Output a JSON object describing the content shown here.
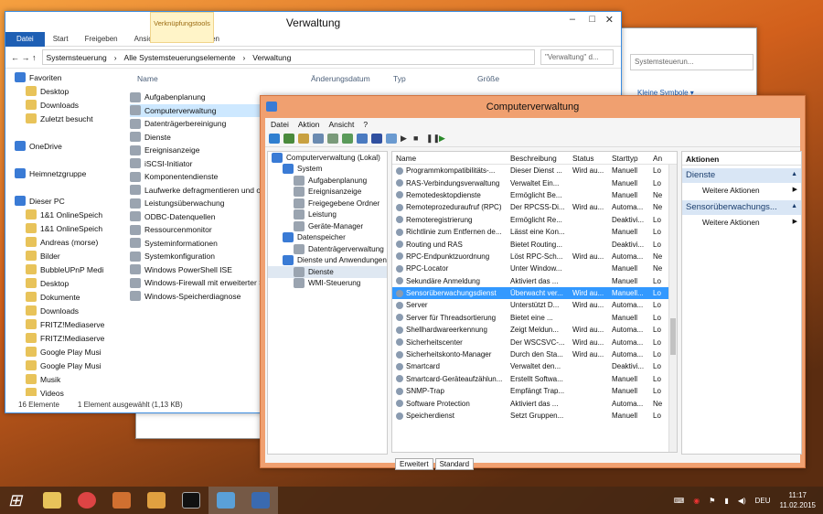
{
  "explorer": {
    "title": "Verwaltung",
    "ctx_tool": "Verknüpfungstools",
    "tabs": [
      "Datei",
      "Start",
      "Freigeben",
      "Ansicht",
      "Verwalten"
    ],
    "path": [
      "Systemsteuerung",
      "Alle Systemsteuerungselemente",
      "Verwaltung"
    ],
    "search_placeholder": "\"Verwaltung\" d...",
    "nav": [
      {
        "label": "Favoriten",
        "hd": true
      },
      {
        "label": "Desktop"
      },
      {
        "label": "Downloads"
      },
      {
        "label": "Zuletzt besucht"
      },
      {
        "label": ""
      },
      {
        "label": "OneDrive",
        "hd": true
      },
      {
        "label": ""
      },
      {
        "label": "Heimnetzgruppe",
        "hd": true
      },
      {
        "label": ""
      },
      {
        "label": "Dieser PC",
        "hd": true
      },
      {
        "label": "1&1 OnlineSpeich"
      },
      {
        "label": "1&1 OnlineSpeich"
      },
      {
        "label": "Andreas (morse)"
      },
      {
        "label": "Bilder"
      },
      {
        "label": "BubbleUPnP Medi"
      },
      {
        "label": "Desktop"
      },
      {
        "label": "Dokumente"
      },
      {
        "label": "Downloads"
      },
      {
        "label": "FRITZ!Mediaserve"
      },
      {
        "label": "FRITZ!Mediaserve"
      },
      {
        "label": "Google Play Musi"
      },
      {
        "label": "Google Play Musi"
      },
      {
        "label": "Musik"
      },
      {
        "label": "Videos"
      }
    ],
    "columns": [
      "Name",
      "Änderungsdatum",
      "Typ",
      "Größe"
    ],
    "files": [
      "Aufgabenplanung",
      "Computerverwaltung",
      "Datenträgerbereinigung",
      "Dienste",
      "Ereignisanzeige",
      "iSCSI-Initiator",
      "Komponentendienste",
      "Laufwerke defragmentieren und o",
      "Leistungsüberwachung",
      "ODBC-Datenquellen",
      "Ressourcenmonitor",
      "Systeminformationen",
      "Systemkonfiguration",
      "Windows PowerShell ISE",
      "Windows-Firewall mit erweiterter S",
      "Windows-Speicherdiagnose"
    ],
    "status_count": "16 Elemente",
    "status_sel": "1 Element ausgewählt (1,13 KB)"
  },
  "back": {
    "search": "Systemsteuerun...",
    "view": "Kleine Symbole ▾"
  },
  "cm": {
    "title": "Computerverwaltung",
    "menu": [
      "Datei",
      "Aktion",
      "Ansicht",
      "?"
    ],
    "tree": [
      {
        "label": "Computerverwaltung (Lokal)",
        "lvl": 0
      },
      {
        "label": "System",
        "lvl": 1
      },
      {
        "label": "Aufgabenplanung",
        "lvl": 2
      },
      {
        "label": "Ereignisanzeige",
        "lvl": 2
      },
      {
        "label": "Freigegebene Ordner",
        "lvl": 2
      },
      {
        "label": "Leistung",
        "lvl": 2
      },
      {
        "label": "Geräte-Manager",
        "lvl": 2
      },
      {
        "label": "Datenspeicher",
        "lvl": 1
      },
      {
        "label": "Datenträgerverwaltung",
        "lvl": 2
      },
      {
        "label": "Dienste und Anwendungen",
        "lvl": 1
      },
      {
        "label": "Dienste",
        "lvl": 2
      },
      {
        "label": "WMI-Steuerung",
        "lvl": 2
      }
    ],
    "cols": [
      "Name",
      "Beschreibung",
      "Status",
      "Starttyp",
      "An"
    ],
    "rows": [
      [
        "Programmkompatibilitäts-...",
        "Dieser Dienst ...",
        "Wird au...",
        "Manuell",
        "Lo"
      ],
      [
        "RAS-Verbindungsverwaltung",
        "Verwaltet Ein...",
        "",
        "Manuell",
        "Lo"
      ],
      [
        "Remotedesktopdienste",
        "Ermöglicht Be...",
        "",
        "Manuell",
        "Ne"
      ],
      [
        "Remoteprozeduraufruf (RPC)",
        "Der RPCSS-Di...",
        "Wird au...",
        "Automa...",
        "Ne"
      ],
      [
        "Remoteregistrierung",
        "Ermöglicht Re...",
        "",
        "Deaktivi...",
        "Lo"
      ],
      [
        "Richtlinie zum Entfernen de...",
        "Lässt eine Kon...",
        "",
        "Manuell",
        "Lo"
      ],
      [
        "Routing und RAS",
        "Bietet Routing...",
        "",
        "Deaktivi...",
        "Lo"
      ],
      [
        "RPC-Endpunktzuordnung",
        "Löst RPC-Sch...",
        "Wird au...",
        "Automa...",
        "Ne"
      ],
      [
        "RPC-Locator",
        "Unter Window...",
        "",
        "Manuell",
        "Ne"
      ],
      [
        "Sekundäre Anmeldung",
        "Aktiviert das ...",
        "",
        "Manuell",
        "Lo"
      ],
      [
        "Sensorüberwachungsdienst",
        "Überwacht ver...",
        "Wird au...",
        "Manuell...",
        "Lo"
      ],
      [
        "Server",
        "Unterstützt D...",
        "Wird au...",
        "Automa...",
        "Lo"
      ],
      [
        "Server für Threadsortierung",
        "Bietet eine ...",
        "",
        "Manuell",
        "Lo"
      ],
      [
        "Shellhardwareerkennung",
        "Zeigt Meldun...",
        "Wird au...",
        "Automa...",
        "Lo"
      ],
      [
        "Sicherheitscenter",
        "Der WSCSVC-...",
        "Wird au...",
        "Automa...",
        "Lo"
      ],
      [
        "Sicherheitskonto-Manager",
        "Durch den Sta...",
        "Wird au...",
        "Automa...",
        "Lo"
      ],
      [
        "Smartcard",
        "Verwaltet den...",
        "",
        "Deaktivi...",
        "Lo"
      ],
      [
        "Smartcard-Geräteaufzählun...",
        "Erstellt Softwa...",
        "",
        "Manuell",
        "Lo"
      ],
      [
        "SNMP-Trap",
        "Empfängt Trap...",
        "",
        "Manuell",
        "Lo"
      ],
      [
        "Software Protection",
        "Aktiviert das ...",
        "",
        "Automa...",
        "Ne"
      ],
      [
        "Speicherdienst",
        "Setzt Gruppen...",
        "",
        "Manuell",
        "Lo"
      ]
    ],
    "selected_row": 10,
    "tabs": [
      "Erweitert",
      "Standard"
    ],
    "actions_title": "Aktionen",
    "groups": [
      {
        "title": "Dienste",
        "item": "Weitere Aktionen"
      },
      {
        "title": "Sensorüberwachungs...",
        "item": "Weitere Aktionen"
      }
    ]
  },
  "taskbar": {
    "lang": "DEU",
    "time": "11:17",
    "date": "11.02.2015"
  }
}
